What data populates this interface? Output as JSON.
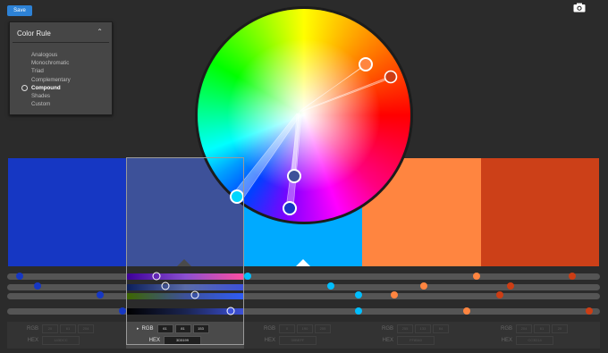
{
  "toolbar": {
    "save_label": "Save",
    "camera_icon": "camera-icon"
  },
  "rule_panel": {
    "title": "Color Rule",
    "items": [
      {
        "label": "Analogous",
        "selected": false
      },
      {
        "label": "Monochromatic",
        "selected": false
      },
      {
        "label": "Triad",
        "selected": false
      },
      {
        "label": "Complementary",
        "selected": false
      },
      {
        "label": "Compound",
        "selected": true
      },
      {
        "label": "Shades",
        "selected": false
      },
      {
        "label": "Custom",
        "selected": false
      }
    ]
  },
  "swatches": [
    {
      "color": "#1637c3"
    },
    {
      "color": "#3d5199",
      "selected": true
    },
    {
      "color": "#00aaff"
    },
    {
      "color": "#ff8540"
    },
    {
      "color": "#cc4018"
    }
  ],
  "values": [
    {
      "rgb_label": "RGB",
      "rgb": [
        "20",
        "61",
        "204"
      ],
      "hex_label": "HEX",
      "hex": "143DCC"
    },
    {
      "rgb_label": "RGB",
      "rgb": [
        "61",
        "81",
        "153"
      ],
      "hex_label": "HEX",
      "hex": "3D5199"
    },
    {
      "rgb_label": "RGB",
      "rgb": [
        "0",
        "190",
        "255"
      ],
      "hex_label": "HEX",
      "hex": "00BEFF"
    },
    {
      "rgb_label": "RGB",
      "rgb": [
        "255",
        "133",
        "64"
      ],
      "hex_label": "HEX",
      "hex": "FF8540"
    },
    {
      "rgb_label": "RGB",
      "rgb": [
        "204",
        "61",
        "20"
      ],
      "hex_label": "HEX",
      "hex": "CC3D14"
    }
  ],
  "colors": {
    "accent": "#2d82d6",
    "background": "#2b2b2b"
  }
}
